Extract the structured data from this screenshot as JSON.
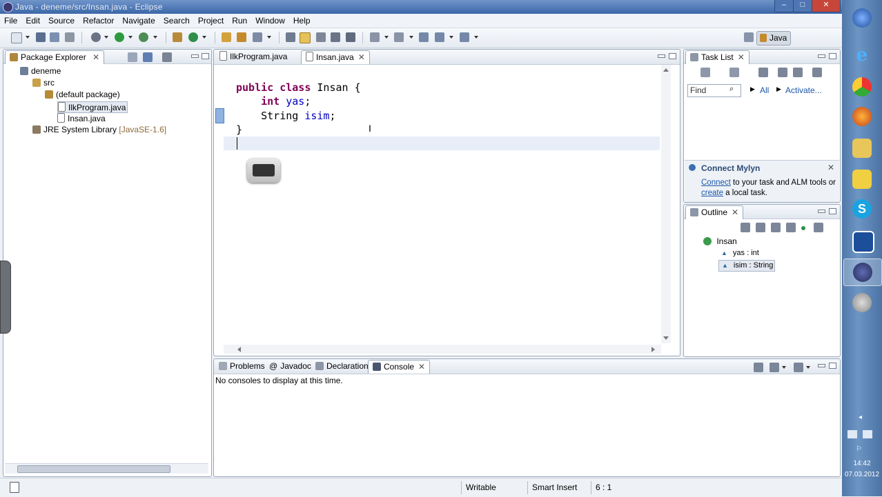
{
  "window": {
    "title": "Java - deneme/src/Insan.java - Eclipse",
    "minimize": "–",
    "maximize": "□",
    "close": "✕"
  },
  "menu": [
    "File",
    "Edit",
    "Source",
    "Refactor",
    "Navigate",
    "Search",
    "Project",
    "Run",
    "Window",
    "Help"
  ],
  "perspective": {
    "label": "Java"
  },
  "package_explorer": {
    "tab": "Package Explorer",
    "tree": [
      {
        "label": "deneme",
        "icon": "project-icon"
      },
      {
        "label": "src",
        "icon": "source-folder-icon"
      },
      {
        "label": "(default package)",
        "icon": "package-icon"
      },
      {
        "label": "IlkProgram.java",
        "icon": "java-file-icon",
        "selected": true
      },
      {
        "label": "Insan.java",
        "icon": "java-file-icon"
      },
      {
        "label": "JRE System Library",
        "suffix": "[JavaSE-1.6]",
        "icon": "library-icon"
      }
    ]
  },
  "editor": {
    "tabs": [
      {
        "label": "IlkProgram.java",
        "active": false
      },
      {
        "label": "Insan.java",
        "active": true
      }
    ],
    "lines": [
      [
        "public class Insan {"
      ],
      [
        "    int yas;"
      ],
      [
        "    String isim;"
      ],
      [
        "}"
      ],
      [
        ""
      ]
    ],
    "keyword_public": "public",
    "keyword_class": "class",
    "class_name": "Insan",
    "kw_int": "int",
    "field_yas": "yas",
    "type_string": "String",
    "field_isim": "isim"
  },
  "task_list": {
    "tab": "Task List",
    "find_placeholder": "Find",
    "filter_all": "All",
    "filter_activate": "Activate..."
  },
  "mylyn": {
    "title": "Connect Mylyn",
    "connect_link": "Connect",
    "text_1": "to your task and ALM tools or",
    "create_link": "create",
    "text_2": "a local task."
  },
  "outline": {
    "tab": "Outline",
    "items": [
      {
        "label": "Insan",
        "icon": "class-icon"
      },
      {
        "label": "yas : int",
        "icon": "field-icon"
      },
      {
        "label": "isim : String",
        "icon": "field-icon",
        "selected": true
      }
    ]
  },
  "bottom": {
    "tabs": [
      "Problems",
      "Javadoc",
      "Declaration",
      "Console"
    ],
    "active_tab": "Console",
    "message": "No consoles to display at this time."
  },
  "status": {
    "writable": "Writable",
    "insert_mode": "Smart Insert",
    "position": "6 : 1"
  },
  "clock": {
    "time": "14:42",
    "date": "07.03.2012"
  }
}
